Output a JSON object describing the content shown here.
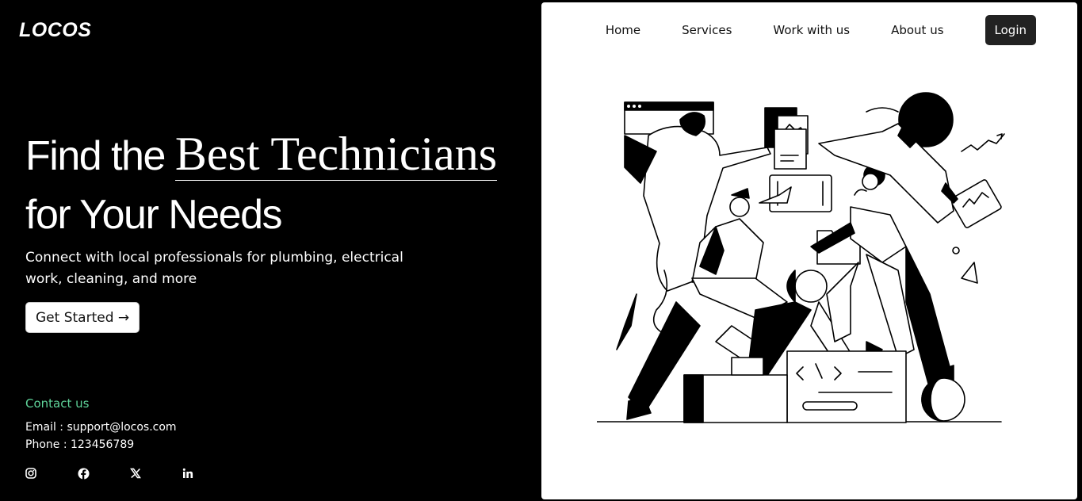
{
  "brand": {
    "name": "LOCOS"
  },
  "nav": {
    "items": [
      "Home",
      "Services",
      "Work with us",
      "About us"
    ],
    "login_label": "Login"
  },
  "hero": {
    "headline_pre": "Find the ",
    "headline_accent": "Best Technicians",
    "headline_post": "for Your Needs",
    "subtitle": "Connect with local professionals for plumbing, electrical work, cleaning, and more",
    "cta_label": "Get Started →"
  },
  "contact": {
    "title": "Contact us",
    "email": "Email : support@locos.com",
    "phone": "Phone : 123456789"
  },
  "socials": [
    "instagram-icon",
    "facebook-icon",
    "x-icon",
    "linkedin-icon"
  ],
  "colors": {
    "background": "#000000",
    "panel": "#ffffff",
    "accent_green": "#5fd49a",
    "login_bg": "#222222"
  }
}
